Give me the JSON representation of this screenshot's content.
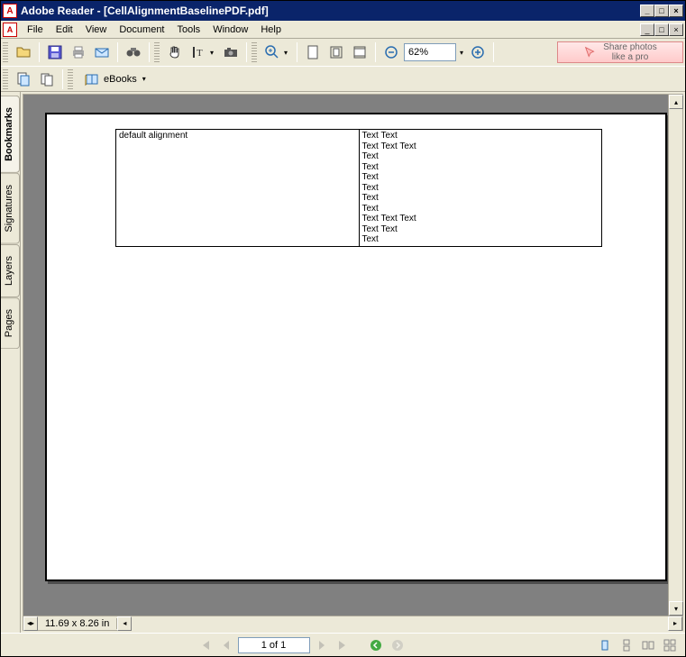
{
  "title": "Adobe Reader - [CellAlignmentBaselinePDF.pdf]",
  "menus": {
    "file": "File",
    "edit": "Edit",
    "view": "View",
    "document": "Document",
    "tools": "Tools",
    "window": "Window",
    "help": "Help"
  },
  "toolbar": {
    "zoom": "62%",
    "ebooks": "eBooks",
    "promo_line1": "Share photos",
    "promo_line2": "like a pro"
  },
  "side_tabs": {
    "bookmarks": "Bookmarks",
    "signatures": "Signatures",
    "layers": "Layers",
    "pages": "Pages"
  },
  "doc": {
    "dimensions": "11.69 x 8.26 in",
    "table": {
      "left": "default alignment",
      "right_lines": [
        "Text Text",
        "Text Text Text",
        "Text",
        "Text",
        "Text",
        "Text",
        "Text",
        "Text",
        "Text Text Text",
        "Text Text",
        "Text"
      ]
    }
  },
  "nav": {
    "page": "1 of 1"
  },
  "colors": {
    "titlebar": "#0a246a",
    "chrome": "#ece9d8",
    "canvas": "#808080"
  }
}
